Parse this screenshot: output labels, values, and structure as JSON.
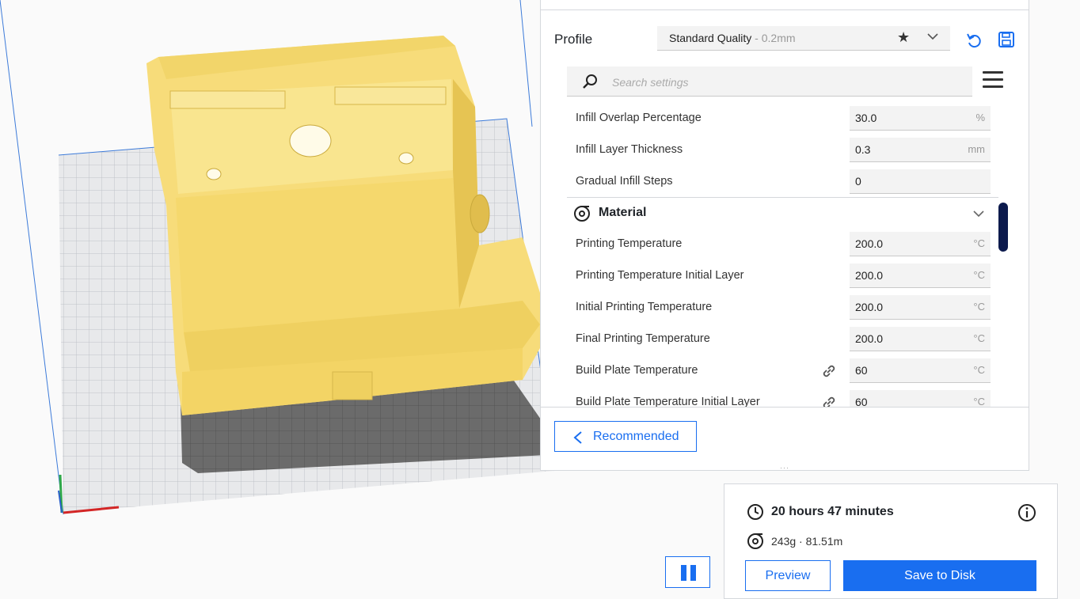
{
  "profile": {
    "label": "Profile",
    "quality_name": "Standard Quality",
    "quality_sub": " - 0.2mm"
  },
  "search": {
    "placeholder": "Search settings"
  },
  "settings": {
    "rows_top": [
      {
        "label": "Infill Overlap Percentage",
        "value": "30.0",
        "unit": "%"
      },
      {
        "label": "Infill Layer Thickness",
        "value": "0.3",
        "unit": "mm"
      },
      {
        "label": "Gradual Infill Steps",
        "value": "0",
        "unit": ""
      }
    ],
    "section_title": "Material",
    "rows_material": [
      {
        "label": "Printing Temperature",
        "value": "200.0",
        "unit": "°C"
      },
      {
        "label": "Printing Temperature Initial Layer",
        "value": "200.0",
        "unit": "°C"
      },
      {
        "label": "Initial Printing Temperature",
        "value": "200.0",
        "unit": "°C"
      },
      {
        "label": "Final Printing Temperature",
        "value": "200.0",
        "unit": "°C"
      },
      {
        "label": "Build Plate Temperature",
        "value": "60",
        "unit": "°C"
      },
      {
        "label": "Build Plate Temperature Initial Layer",
        "value": "60",
        "unit": "°C"
      }
    ]
  },
  "buttons": {
    "recommended": "Recommended",
    "preview": "Preview",
    "save": "Save to Disk"
  },
  "job": {
    "time": "20 hours 47 minutes",
    "material": "243g · 81.51m"
  },
  "colors": {
    "accent": "#196ef0",
    "model": "#f7dc7a",
    "scrollbar": "#0c1a4d"
  }
}
